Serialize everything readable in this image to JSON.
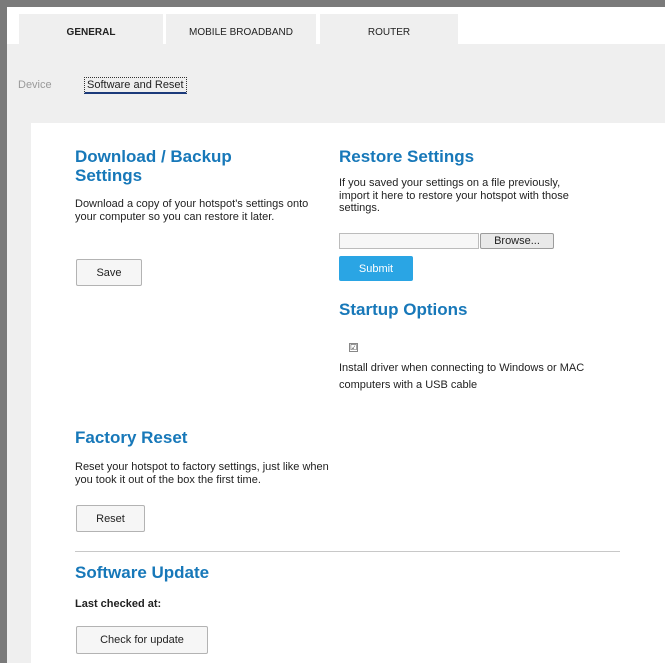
{
  "tabs": {
    "general": "GENERAL",
    "mobile_broadband": "MOBILE BROADBAND",
    "router": "ROUTER"
  },
  "breadcrumb": {
    "device": "Device",
    "current": "Software and Reset"
  },
  "download_backup": {
    "title": "Download / Backup Settings",
    "description": "Download a copy of your hotspot's settings onto your computer so you can restore it later.",
    "save_label": "Save"
  },
  "restore": {
    "title": "Restore Settings",
    "description": "If you saved your settings on a file previously, import it here to restore your hotspot with those settings.",
    "file_value": "",
    "browse_label": "Browse...",
    "submit_label": "Submit"
  },
  "startup": {
    "title": "Startup Options",
    "checkbox_checked": true,
    "checkbox_mark": "☑",
    "option_label": "Install driver when connecting to Windows or MAC computers with a USB cable"
  },
  "factory_reset": {
    "title": "Factory Reset",
    "description": "Reset your hotspot to factory settings, just like when you took it out of the box the first time.",
    "reset_label": "Reset"
  },
  "software_update": {
    "title": "Software Update",
    "last_checked_label": "Last checked at:",
    "check_label": "Check for update"
  },
  "colors": {
    "accent": "#1778b9",
    "submit": "#2aa5e4",
    "frame": "#7a7a7a",
    "background": "#efefef"
  }
}
